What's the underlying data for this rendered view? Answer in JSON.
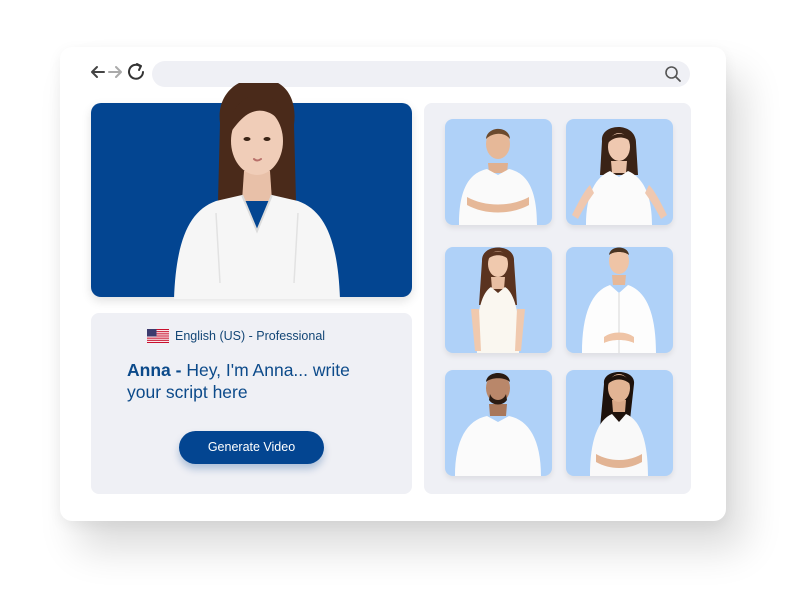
{
  "browser": {
    "icons": {
      "back": "arrow-left-icon",
      "forward": "arrow-right-icon",
      "reload": "reload-icon",
      "search": "search-icon"
    }
  },
  "presenter": {
    "language_label": "English (US) - Professional",
    "flag": "us-flag-icon",
    "name": "Anna -",
    "script": "Hey, I'm Anna... write your script here",
    "generate_button": "Generate Video"
  },
  "avatars": [
    {
      "id": "avatar-man-1"
    },
    {
      "id": "avatar-woman-1"
    },
    {
      "id": "avatar-woman-2"
    },
    {
      "id": "avatar-man-2"
    },
    {
      "id": "avatar-man-3"
    },
    {
      "id": "avatar-woman-3"
    }
  ],
  "colors": {
    "brand": "#034591",
    "panel": "#eff0f5",
    "tile": "#afd1f8"
  }
}
